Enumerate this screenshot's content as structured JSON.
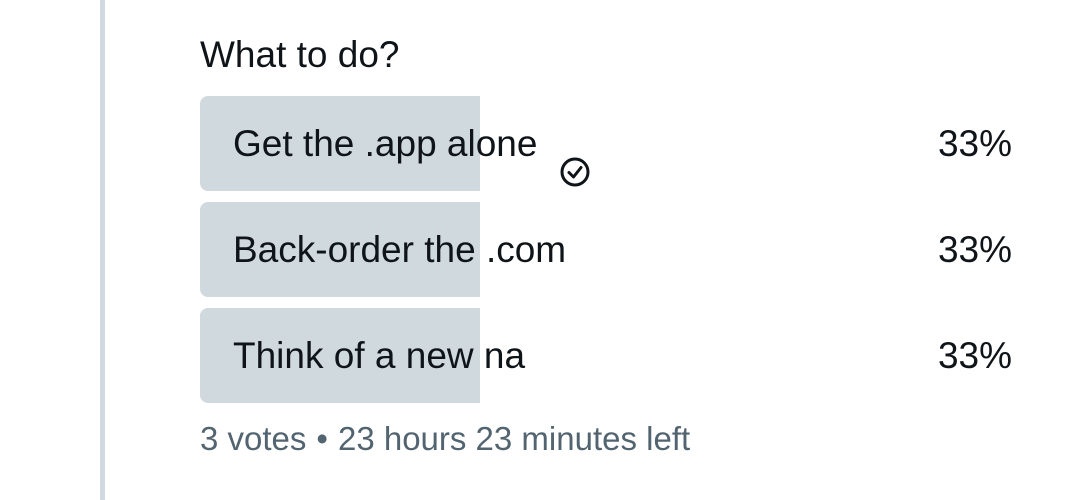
{
  "poll": {
    "question": "What to do?",
    "options": [
      {
        "label": "Get the .app alone",
        "percent": "33%",
        "fill_fraction": 0.33,
        "selected": true,
        "icon": "checkmark-circle-icon"
      },
      {
        "label": "Back-order the .com",
        "percent": "33%",
        "fill_fraction": 0.33,
        "selected": false
      },
      {
        "label": "Think of a new na",
        "percent": "33%",
        "fill_fraction": 0.33,
        "selected": false
      }
    ],
    "votes": "3 votes",
    "separator": "•",
    "time_left": "23 hours 23 minutes left"
  },
  "colors": {
    "bar": "#cfd9de",
    "text": "#0f1419",
    "muted": "#536471",
    "thread_line": "#cfd9de"
  }
}
